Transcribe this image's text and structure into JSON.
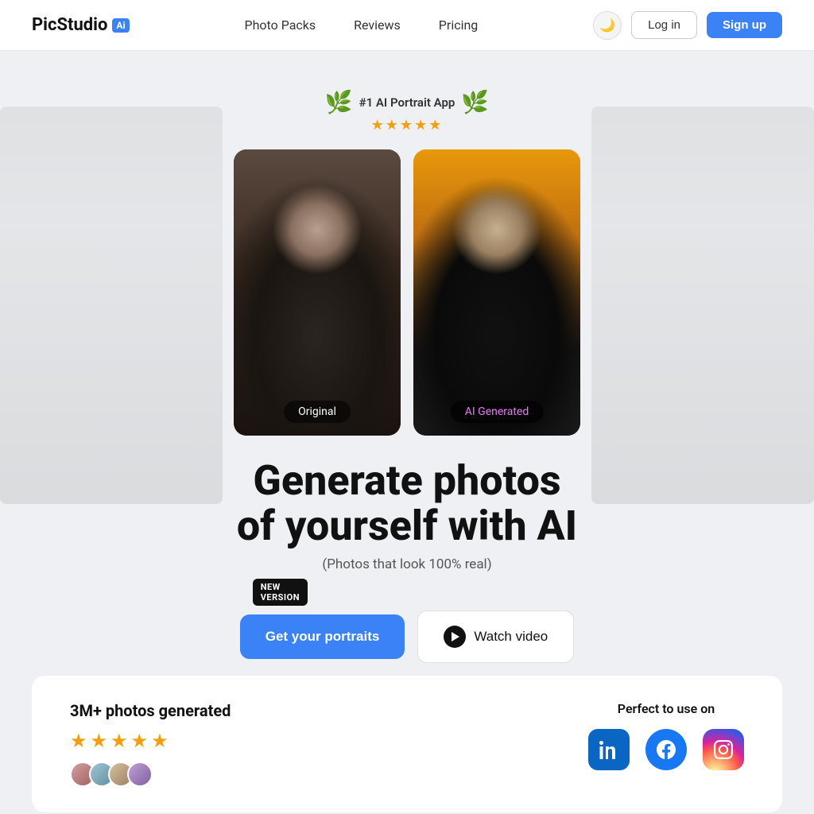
{
  "nav": {
    "logo_text": "PicStudio",
    "logo_badge": "Ai",
    "links": [
      {
        "id": "photo-packs",
        "label": "Photo Packs"
      },
      {
        "id": "reviews",
        "label": "Reviews"
      },
      {
        "id": "pricing",
        "label": "Pricing"
      }
    ],
    "theme_icon": "🌙",
    "login_label": "Log in",
    "signup_label": "Sign up"
  },
  "hero": {
    "award_text": "#1 AI Portrait App",
    "award_stars": "★★★★★",
    "photo_label_original": "Original",
    "photo_label_ai": "AI Generated",
    "headline_line1": "Generate photos",
    "headline_line2": "of yourself with AI",
    "subheadline": "(Photos that look 100% real)",
    "new_version_badge": "NEW\nVERSION",
    "btn_get_portraits": "Get your portraits",
    "btn_watch_video": "Watch video"
  },
  "stats": {
    "photos_generated": "3M+ photos generated",
    "stars": "★★★★★",
    "perfect_label": "Perfect to use on",
    "socials": [
      {
        "id": "linkedin",
        "label": "in"
      },
      {
        "id": "facebook",
        "label": "f"
      },
      {
        "id": "instagram",
        "label": "📷"
      }
    ]
  }
}
